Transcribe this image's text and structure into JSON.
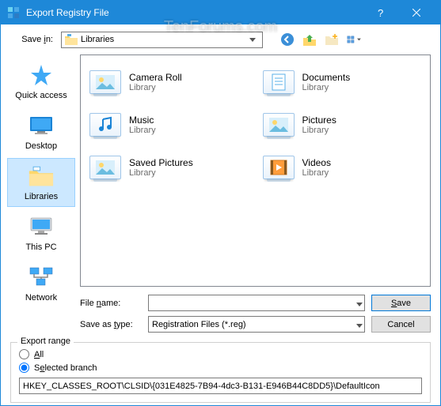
{
  "window": {
    "title": "Export Registry File"
  },
  "watermark": "TenForums.com",
  "toolbar": {
    "save_in_label": "Save in:",
    "location": "Libraries",
    "icons": {
      "back": "back-icon",
      "up": "up-icon",
      "newfolder": "new-folder-icon",
      "view": "view-menu-icon"
    }
  },
  "places": [
    {
      "id": "quick-access",
      "label": "Quick access",
      "selected": false
    },
    {
      "id": "desktop",
      "label": "Desktop",
      "selected": false
    },
    {
      "id": "libraries",
      "label": "Libraries",
      "selected": true
    },
    {
      "id": "this-pc",
      "label": "This PC",
      "selected": false
    },
    {
      "id": "network",
      "label": "Network",
      "selected": false
    }
  ],
  "items": [
    {
      "name": "Camera Roll",
      "type": "Library",
      "icon": "photo"
    },
    {
      "name": "Documents",
      "type": "Library",
      "icon": "document"
    },
    {
      "name": "Music",
      "type": "Library",
      "icon": "music"
    },
    {
      "name": "Pictures",
      "type": "Library",
      "icon": "pictures"
    },
    {
      "name": "Saved Pictures",
      "type": "Library",
      "icon": "photo"
    },
    {
      "name": "Videos",
      "type": "Library",
      "icon": "video"
    }
  ],
  "fields": {
    "file_name_label": "File name:",
    "file_name_value": "",
    "save_as_type_label": "Save as type:",
    "save_as_type_value": "Registration Files (*.reg)",
    "save_button": "Save",
    "cancel_button": "Cancel"
  },
  "export": {
    "legend": "Export range",
    "all_label": "All",
    "selected_label": "Selected branch",
    "mode": "selected",
    "branch_value": "HKEY_CLASSES_ROOT\\CLSID\\{031E4825-7B94-4dc3-B131-E946B44C8DD5}\\DefaultIcon"
  }
}
